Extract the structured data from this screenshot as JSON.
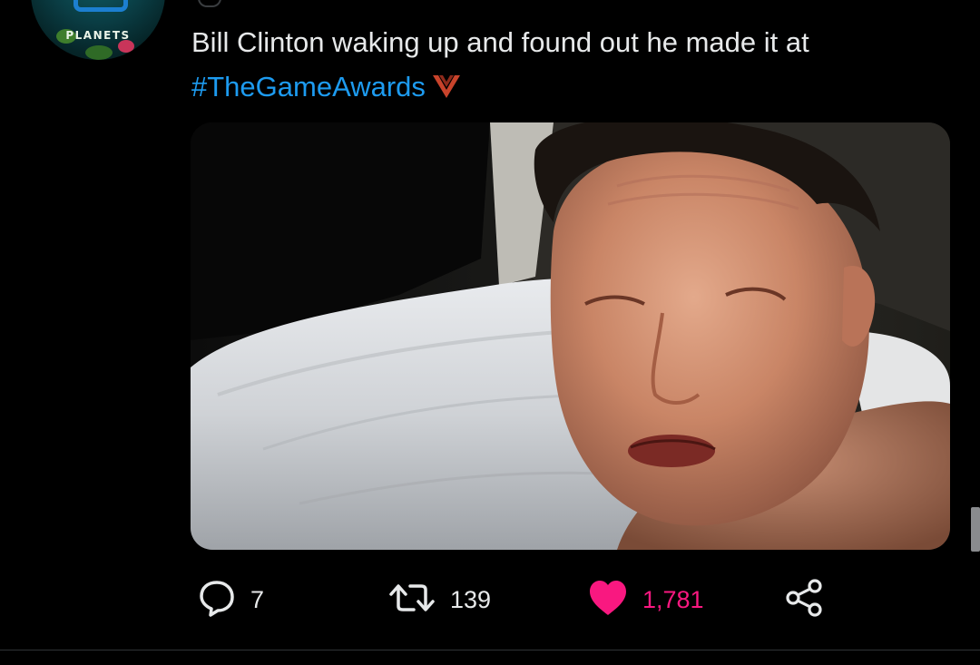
{
  "author": {
    "avatar_brand_text": "PLANETS"
  },
  "tweet": {
    "text_line1": "Bill Clinton waking up and found out he made it at",
    "hashtag": "#TheGameAwards",
    "media_alt": "photo of a man in bed, crying"
  },
  "actions": {
    "reply_count": "7",
    "retweet_count": "139",
    "like_count": "1,781"
  },
  "colors": {
    "background": "#000000",
    "text": "#e7e9ea",
    "link": "#1d9bf0",
    "like": "#f91880",
    "icon": "#e7e9ea",
    "divider": "#2f3336"
  },
  "icons": {
    "reply": "speech-bubble-icon",
    "retweet": "retweet-arrows-icon",
    "like": "heart-icon",
    "share": "share-nodes-icon",
    "hashflag": "game-awards-v-icon"
  }
}
